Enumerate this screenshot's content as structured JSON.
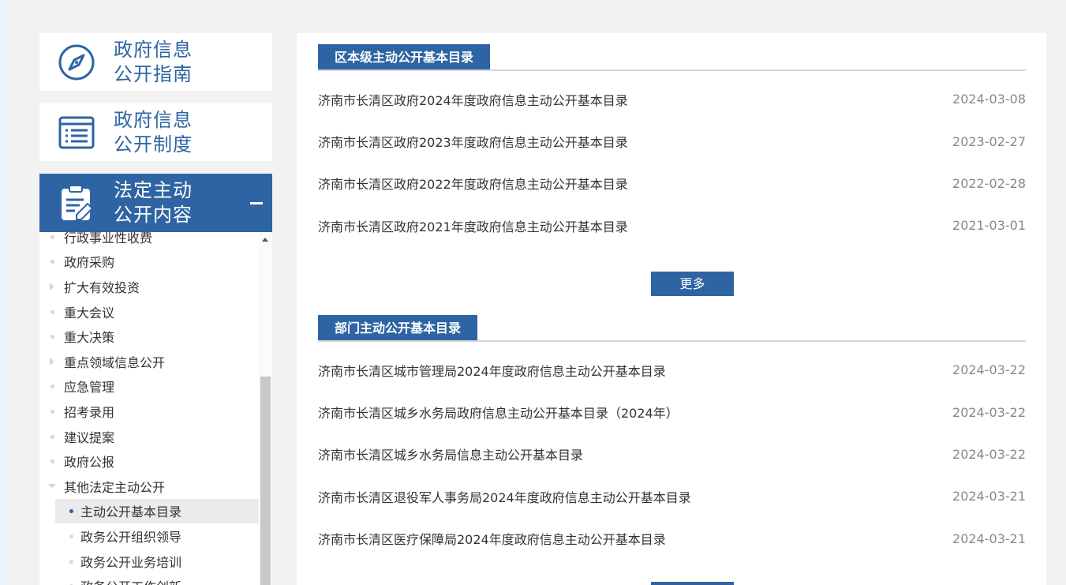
{
  "colors": {
    "accent": "#2e64a3",
    "background": "#f2f2f2",
    "text": "#333333",
    "date": "#888888"
  },
  "sidebar": {
    "blocks": [
      {
        "line1": "政府信息",
        "line2": "公开指南",
        "icon": "compass-icon"
      },
      {
        "line1": "政府信息",
        "line2": "公开制度",
        "icon": "document-list-icon"
      },
      {
        "line1": "法定主动",
        "line2": "公开内容",
        "icon": "clipboard-edit-icon",
        "expanded": true
      }
    ],
    "tree": [
      {
        "label": "行政事业性收费"
      },
      {
        "label": "政府采购"
      },
      {
        "label": "扩大有效投资"
      },
      {
        "label": "重大会议"
      },
      {
        "label": "重大决策"
      },
      {
        "label": "重点领域信息公开"
      },
      {
        "label": "应急管理"
      },
      {
        "label": "招考录用"
      },
      {
        "label": "建议提案"
      },
      {
        "label": "政府公报"
      },
      {
        "label": "其他法定主动公开"
      },
      {
        "label": "主动公开基本目录"
      },
      {
        "label": "政务公开组织领导"
      },
      {
        "label": "政务公开业务培训"
      },
      {
        "label": "政务公开工作创新"
      }
    ]
  },
  "sections": [
    {
      "title": "区本级主动公开基本目录",
      "items": [
        {
          "title": "济南市长清区政府2024年度政府信息主动公开基本目录",
          "date": "2024-03-08"
        },
        {
          "title": "济南市长清区政府2023年度政府信息主动公开基本目录",
          "date": "2023-02-27"
        },
        {
          "title": "济南市长清区政府2022年度政府信息主动公开基本目录",
          "date": "2022-02-28"
        },
        {
          "title": "济南市长清区政府2021年度政府信息主动公开基本目录",
          "date": "2021-03-01"
        }
      ],
      "more": "更多"
    },
    {
      "title": "部门主动公开基本目录",
      "items": [
        {
          "title": "济南市长清区城市管理局2024年度政府信息主动公开基本目录",
          "date": "2024-03-22"
        },
        {
          "title": "济南市长清区城乡水务局政府信息主动公开基本目录（2024年）",
          "date": "2024-03-22"
        },
        {
          "title": "济南市长清区城乡水务局信息主动公开基本目录",
          "date": "2024-03-22"
        },
        {
          "title": "济南市长清区退役军人事务局2024年度政府信息主动公开基本目录",
          "date": "2024-03-21"
        },
        {
          "title": "济南市长清区医疗保障局2024年度政府信息主动公开基本目录",
          "date": "2024-03-21"
        }
      ]
    }
  ]
}
